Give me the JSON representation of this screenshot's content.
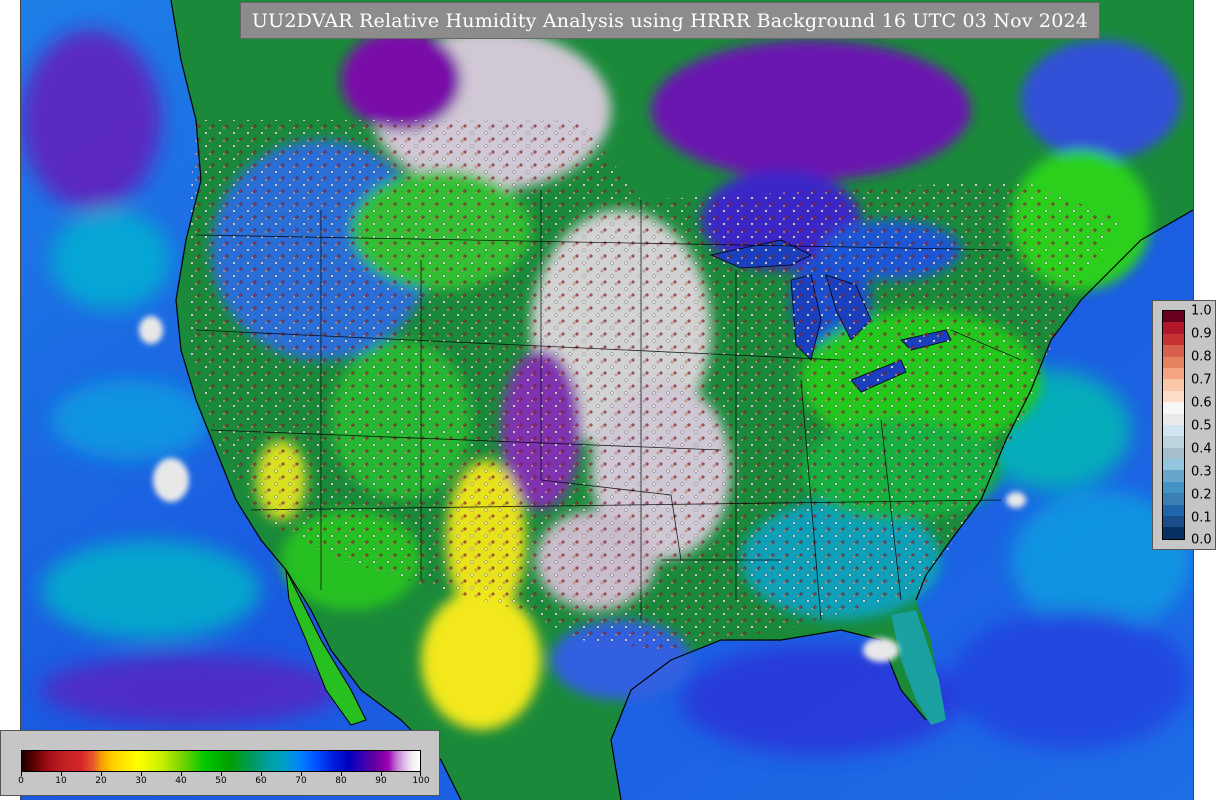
{
  "title": "UU2DVAR Relative Humidity Analysis using HRRR Background 16 UTC 03 Nov 2024",
  "rh_colorbar": {
    "labels": [
      "0",
      "10",
      "20",
      "30",
      "40",
      "50",
      "60",
      "70",
      "80",
      "90",
      "100"
    ]
  },
  "increment_colorbar": {
    "labels": [
      "1.0",
      "0.9",
      "0.8",
      "0.7",
      "0.6",
      "0.5",
      "0.4",
      "0.3",
      "0.2",
      "0.1",
      "0.0"
    ],
    "colors": [
      "#67001f",
      "#b2182b",
      "#c63333",
      "#d6604d",
      "#e58260",
      "#f4a582",
      "#f9c7a9",
      "#fddbc7",
      "#f7f7f7",
      "#eaeaea",
      "#d1e5f0",
      "#bcd4df",
      "#a6bfce",
      "#92c5de",
      "#6aa6cc",
      "#4393c3",
      "#3a7fb5",
      "#2166ac",
      "#1a4d8a",
      "#053061"
    ]
  },
  "colors": {
    "ocean_blue": "#1a6ee0",
    "land_green": "#22c81e",
    "dry_yellow": "#f0e61e",
    "moist_purple": "#7a10a8",
    "saturated_gray": "#d2d2d2",
    "title_bg": "#8c8c8c"
  }
}
